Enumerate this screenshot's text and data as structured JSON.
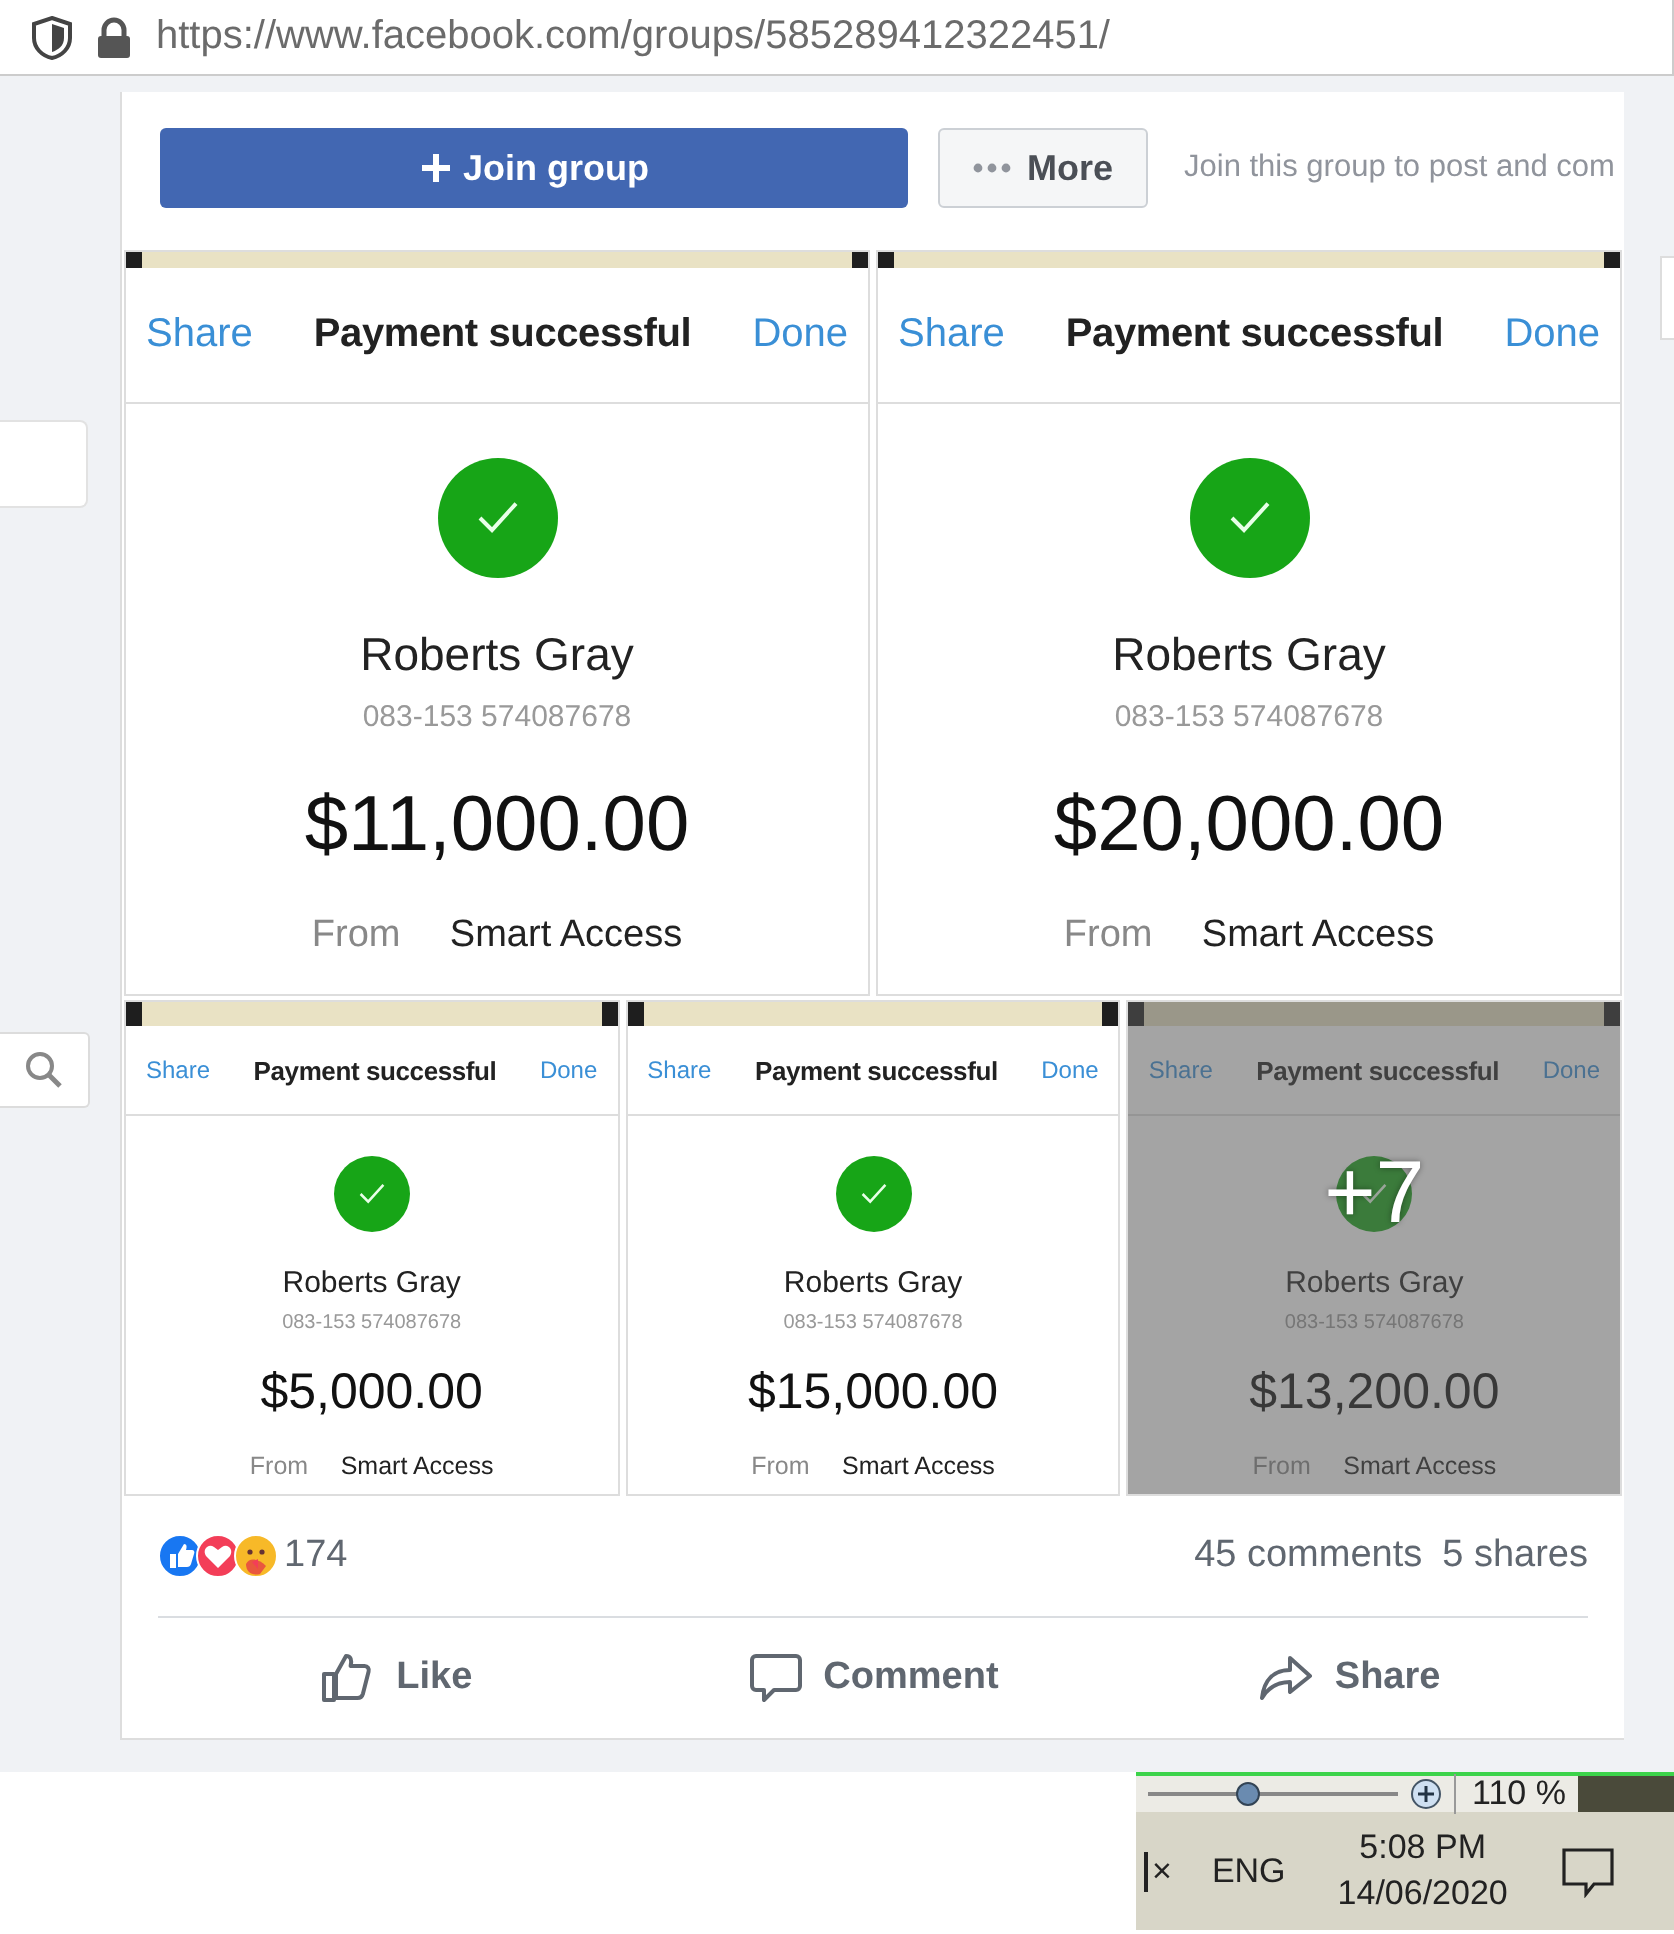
{
  "browser": {
    "url": "https://www.facebook.com/groups/585289412322451/"
  },
  "group_header": {
    "join_button": "Join group",
    "more_button": "More",
    "join_prompt": "Join this group to post and com"
  },
  "photos": [
    {
      "kind": "large",
      "share": "Share",
      "title": "Payment successful",
      "done": "Done",
      "name": "Roberts Gray",
      "account": "083-153 574087678",
      "amount": "$11,000.00",
      "from_label": "From",
      "from_value": "Smart Access"
    },
    {
      "kind": "large",
      "share": "Share",
      "title": "Payment successful",
      "done": "Done",
      "name": "Roberts Gray",
      "account": "083-153 574087678",
      "amount": "$20,000.00",
      "from_label": "From",
      "from_value": "Smart Access"
    },
    {
      "kind": "small",
      "share": "Share",
      "title": "Payment successful",
      "done": "Done",
      "name": "Roberts Gray",
      "account": "083-153 574087678",
      "amount": "$5,000.00",
      "from_label": "From",
      "from_value": "Smart Access"
    },
    {
      "kind": "small",
      "share": "Share",
      "title": "Payment successful",
      "done": "Done",
      "name": "Roberts Gray",
      "account": "083-153 574087678",
      "amount": "$15,000.00",
      "from_label": "From",
      "from_value": "Smart Access"
    },
    {
      "kind": "small",
      "share": "Share",
      "title": "Payment successful",
      "done": "Done",
      "name": "Roberts Gray",
      "account": "083-153 574087678",
      "amount": "$13,200.00",
      "from_label": "From",
      "from_value": "Smart Access",
      "more_count": "+7"
    }
  ],
  "reactions": {
    "icons": [
      {
        "kind": "like"
      },
      {
        "kind": "love"
      },
      {
        "kind": "care"
      }
    ],
    "count": "174"
  },
  "comments": "45 comments",
  "shares": "5 shares",
  "actions": [
    {
      "kind": "like",
      "label": "Like"
    },
    {
      "kind": "comment",
      "label": "Comment"
    },
    {
      "kind": "share",
      "label": "Share"
    }
  ],
  "taskbar": {
    "zoom": {
      "reading": "110 %",
      "level": 0.4
    },
    "close_mark": "×",
    "language": "ENG",
    "time": "5:08 PM",
    "date": "14/06/2020"
  }
}
